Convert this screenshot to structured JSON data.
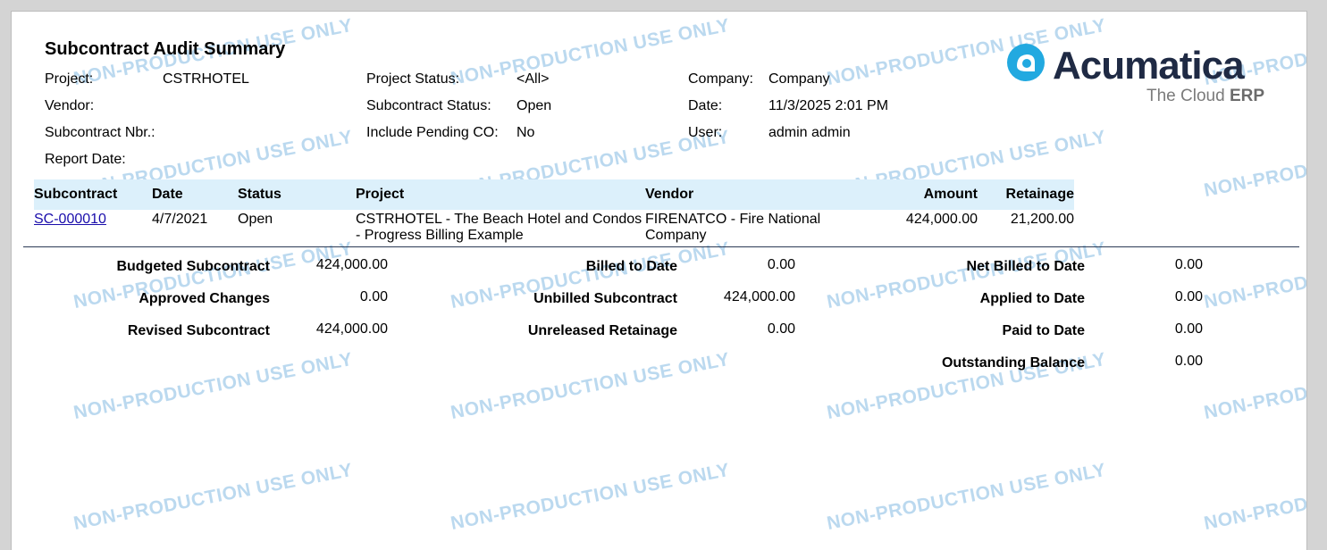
{
  "report": {
    "title": "Subcontract Audit Summary"
  },
  "filters": {
    "project_label": "Project:",
    "project_value": "CSTRHOTEL",
    "vendor_label": "Vendor:",
    "subcontract_nbr_label": "Subcontract Nbr.:",
    "report_date_label": "Report Date:",
    "project_status_label": "Project Status:",
    "project_status_value": "<All>",
    "subcontract_status_label": "Subcontract Status:",
    "subcontract_status_value": "Open",
    "include_pending_label": "Include Pending CO:",
    "include_pending_value": "No",
    "company_label": "Company:",
    "company_value": "Company",
    "date_label": "Date:",
    "date_value": "11/3/2025 2:01 PM",
    "user_label": "User:",
    "user_value": "admin admin"
  },
  "logo": {
    "brand": "Acumatica",
    "tagline_prefix": "The Cloud ",
    "tagline_emph": "ERP",
    "accent": "#22a9e0"
  },
  "table": {
    "headers": {
      "subcontract": "Subcontract",
      "date": "Date",
      "status": "Status",
      "project": "Project",
      "vendor": "Vendor",
      "amount": "Amount",
      "retainage": "Retainage"
    },
    "rows": [
      {
        "subcontract": "SC-000010",
        "date": "4/7/2021",
        "status": "Open",
        "project": "CSTRHOTEL - The Beach Hotel and Condos - Progress Billing Example",
        "vendor": "FIRENATCO - Fire National Company",
        "amount": "424,000.00",
        "retainage": "21,200.00"
      }
    ]
  },
  "summary": {
    "budgeted_label": "Budgeted Subcontract",
    "budgeted_value": "424,000.00",
    "approved_label": "Approved Changes",
    "approved_value": "0.00",
    "revised_label": "Revised Subcontract",
    "revised_value": "424,000.00",
    "billed_label": "Billed to Date",
    "billed_value": "0.00",
    "unbilled_label": "Unbilled Subcontract",
    "unbilled_value": "424,000.00",
    "unreleased_label": "Unreleased Retainage",
    "unreleased_value": "0.00",
    "net_billed_label": "Net Billed to Date",
    "net_billed_value": "0.00",
    "applied_label": "Applied to Date",
    "applied_value": "0.00",
    "paid_label": "Paid to Date",
    "paid_value": "0.00",
    "outstanding_label": "Outstanding Balance",
    "outstanding_value": "0.00"
  },
  "watermark": {
    "text": "NON-PRODUCTION USE ONLY",
    "partial_text": "NON-PROD",
    "color": "#b8d7ef"
  },
  "colors": {
    "header_bg": "#dcf0fb",
    "link": "#1a0dab",
    "brand_dark": "#1f2a44"
  }
}
